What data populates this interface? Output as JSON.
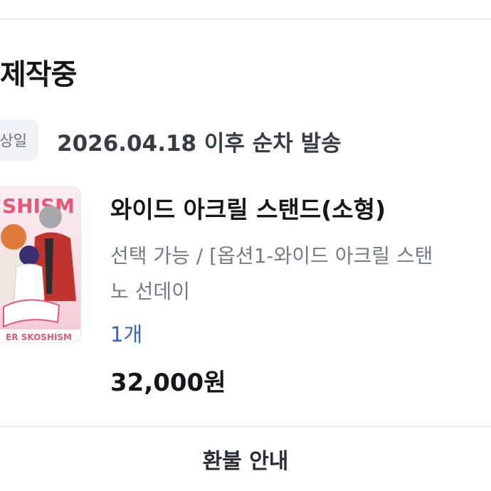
{
  "order": {
    "status_title": "제작중",
    "shipping_badge": "상일",
    "shipping_text": "2026.04.18 이후 순차 발송"
  },
  "product": {
    "thumbnail_text_top": "SHISM",
    "thumbnail_text_bottom": "ER SKOSHISM",
    "title": "와이드 아크릴 스탠드(소형)",
    "option_line1": "선택 가능 / [옵션1-와이드 아크릴 스탠",
    "option_line2": "노 선데이",
    "quantity": "1개",
    "price": "32,000원"
  },
  "footer": {
    "refund_label": "환불 안내"
  },
  "colors": {
    "accent_blue": "#3463c9",
    "badge_bg": "#f1f2f6",
    "thumb_pink": "#e8577a"
  }
}
